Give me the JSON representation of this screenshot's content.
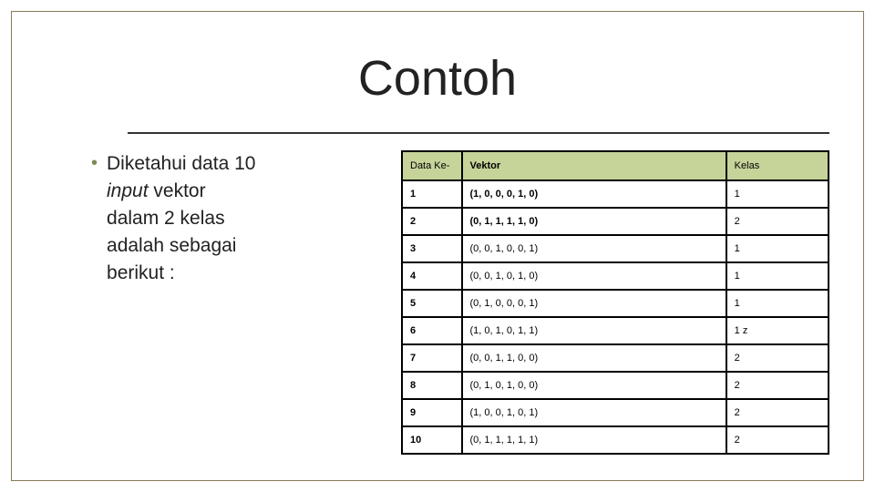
{
  "title": "Contoh",
  "bullet": {
    "line1_prefix": "Diketahui data 10 ",
    "line2_italic": "input",
    "line2_rest": " vektor",
    "line3": "dalam 2 kelas",
    "line4": "adalah sebagai",
    "line5": "berikut :"
  },
  "table": {
    "headers": {
      "col1": "Data Ke-",
      "col2": "Vektor",
      "col3": "Kelas"
    },
    "rows": [
      {
        "n": "1",
        "vektor": "(1, 0, 0, 0, 1, 0)",
        "kelas": "1"
      },
      {
        "n": "2",
        "vektor": "(0, 1, 1, 1, 1, 0)",
        "kelas": "2"
      },
      {
        "n": "3",
        "vektor": "(0, 0, 1, 0, 0, 1)",
        "kelas": "1"
      },
      {
        "n": "4",
        "vektor": "(0, 0, 1, 0, 1, 0)",
        "kelas": "1"
      },
      {
        "n": "5",
        "vektor": "(0, 1, 0, 0, 0, 1)",
        "kelas": "1"
      },
      {
        "n": "6",
        "vektor": "(1, 0, 1, 0, 1, 1)",
        "kelas": "1 z"
      },
      {
        "n": "7",
        "vektor": "(0, 0, 1, 1, 0, 0)",
        "kelas": "2"
      },
      {
        "n": "8",
        "vektor": "(0, 1, 0, 1, 0, 0)",
        "kelas": "2"
      },
      {
        "n": "9",
        "vektor": "(1, 0, 0, 1, 0, 1)",
        "kelas": "2"
      },
      {
        "n": "10",
        "vektor": "(0, 1, 1, 1, 1, 1)",
        "kelas": "2"
      }
    ]
  }
}
